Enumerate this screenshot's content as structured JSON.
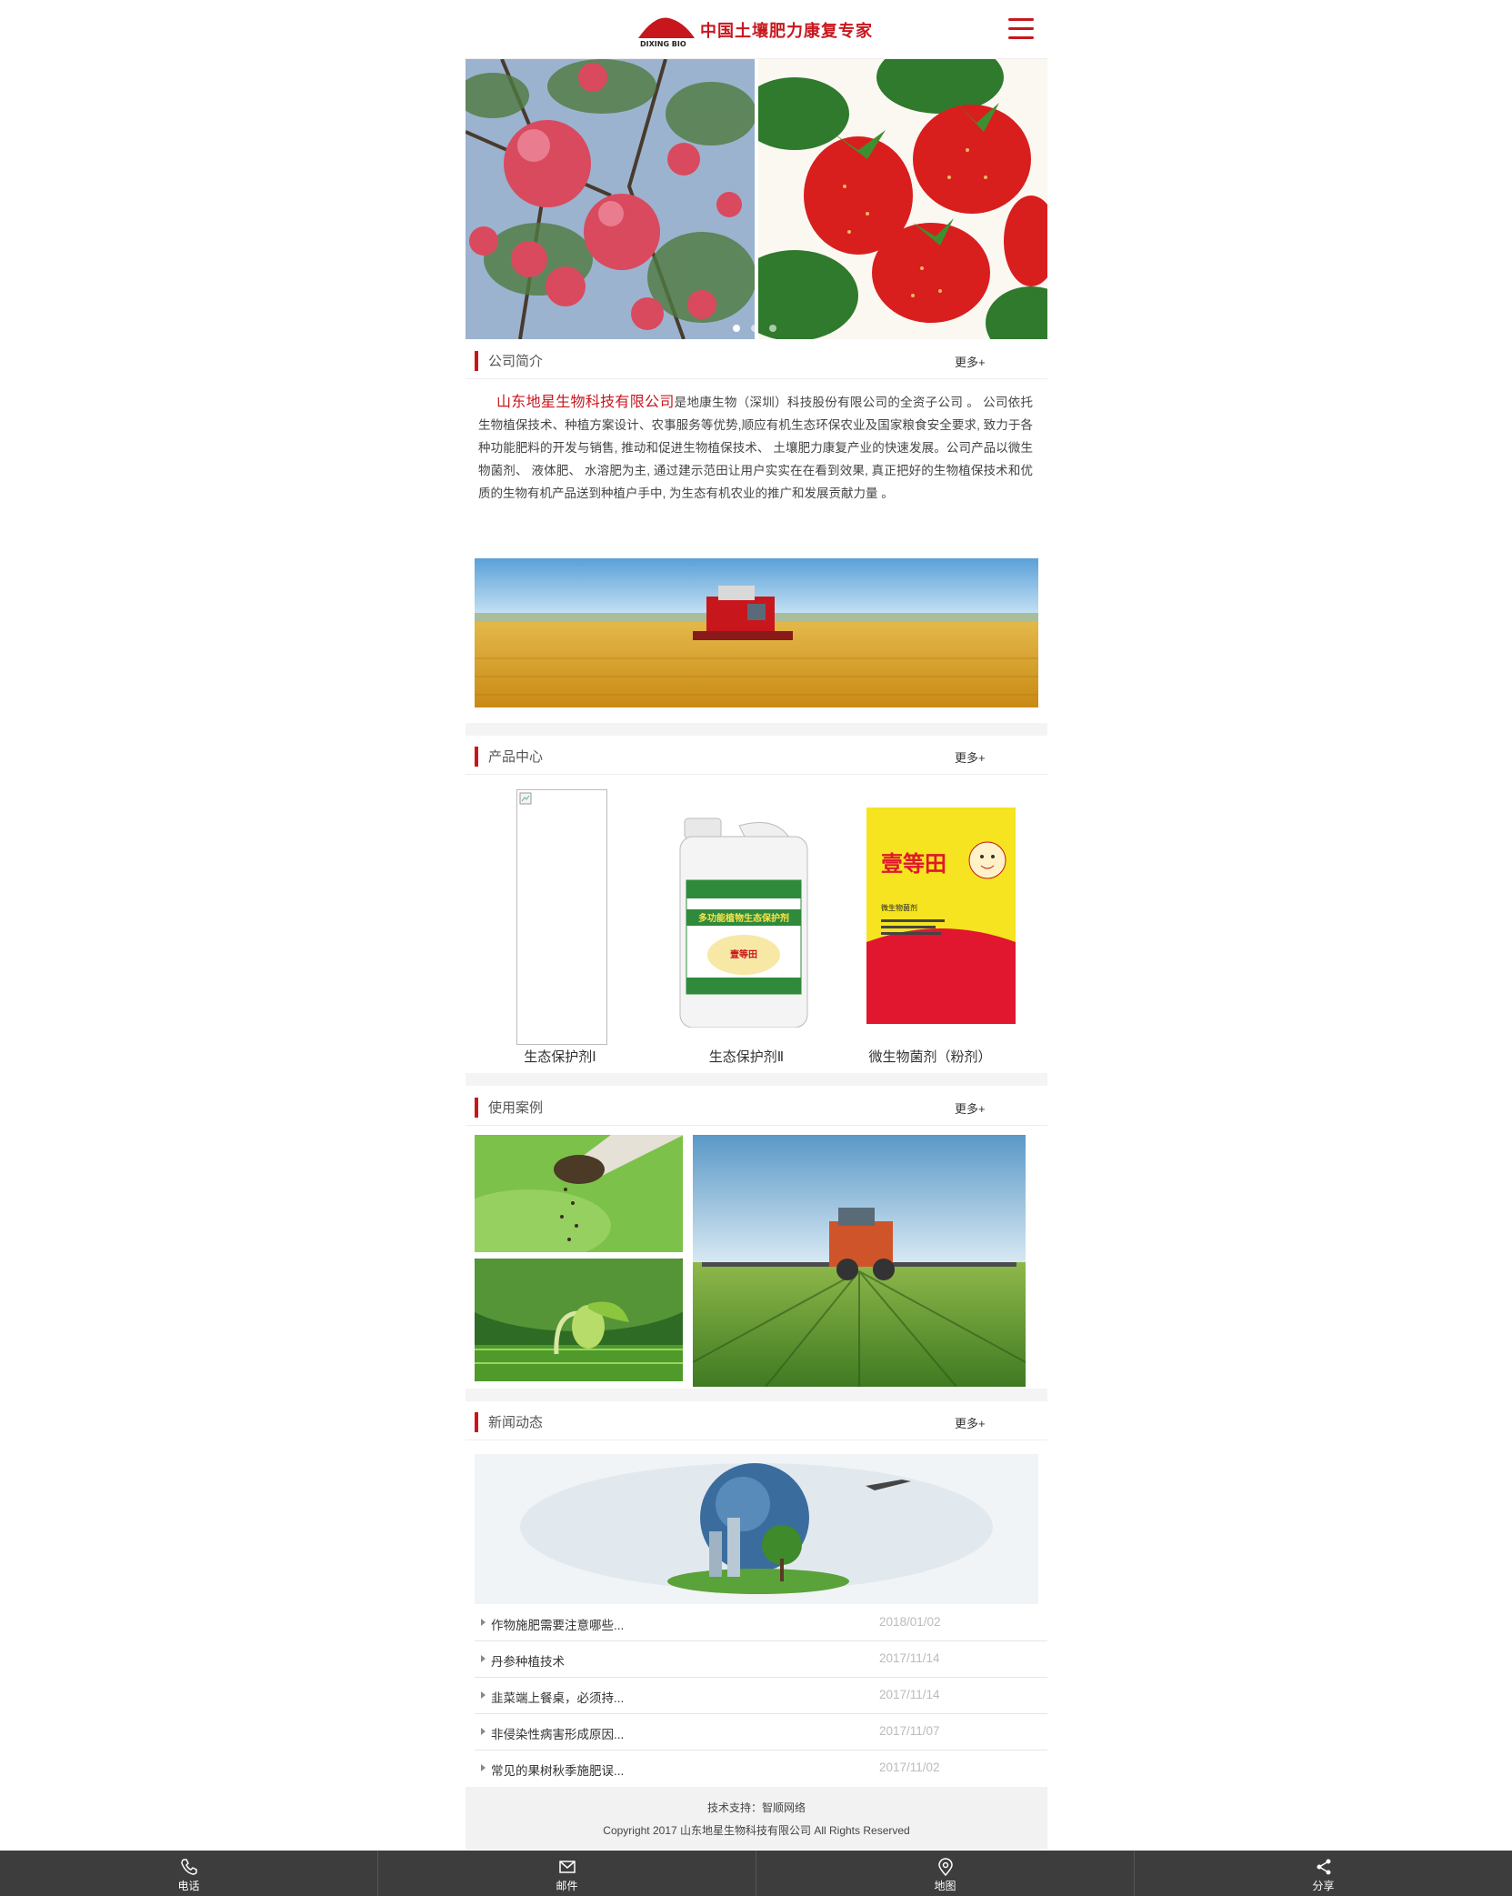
{
  "header": {
    "logo_text": "中国土壤肥力康复专家",
    "logo_sub": "DIXING BIO",
    "brand_color": "#c8161d"
  },
  "banner": {
    "active_slide": 1,
    "slide_count": 3
  },
  "about": {
    "title": "公司简介",
    "more": "更多+",
    "company": "山东地星生物科技有限公司",
    "text": "是地康生物（深圳）科技股份有限公司的全资子公司 。 公司依托生物植保技术、种植方案设计、农事服务等优势,顺应有机生态环保农业及国家粮食安全要求, 致力于各种功能肥料的开发与销售, 推动和促进生物植保技术、 土壤肥力康复产业的快速发展。公司产品以微生物菌剂、 液体肥、 水溶肥为主, 通过建示范田让用户实实在在看到效果, 真正把好的生物植保技术和优质的生物有机产品送到种植户手中, 为生态有机农业的推广和发展贡献力量 。"
  },
  "products": {
    "title": "产品中心",
    "more": "更多+",
    "items": [
      {
        "name": "生态保护剂Ⅰ"
      },
      {
        "name": "生态保护剂Ⅱ",
        "label_text": "多功能植物生态保护剂",
        "brand": "壹等田"
      },
      {
        "name": "微生物菌剂（粉剂）",
        "brand": "壹等田",
        "label_text": "微生物菌剂"
      }
    ]
  },
  "cases": {
    "title": "使用案例",
    "more": "更多+"
  },
  "news": {
    "title": "新闻动态",
    "more": "更多+",
    "items": [
      {
        "title": "作物施肥需要注意哪些...",
        "date": "2018/01/02"
      },
      {
        "title": "丹参种植技术",
        "date": "2017/11/14"
      },
      {
        "title": "韭菜端上餐桌，必须持...",
        "date": "2017/11/14"
      },
      {
        "title": "非侵染性病害形成原因...",
        "date": "2017/11/07"
      },
      {
        "title": "常见的果树秋季施肥误...",
        "date": "2017/11/02"
      }
    ]
  },
  "footer": {
    "tech": "技术支持：智顺网络",
    "copyright": "Copyright 2017 山东地星生物科技有限公司 All Rights Reserved"
  },
  "bottombar": [
    {
      "label": "电话",
      "icon": "phone-icon"
    },
    {
      "label": "邮件",
      "icon": "mail-icon"
    },
    {
      "label": "地图",
      "icon": "map-pin-icon"
    },
    {
      "label": "分享",
      "icon": "share-icon"
    }
  ]
}
